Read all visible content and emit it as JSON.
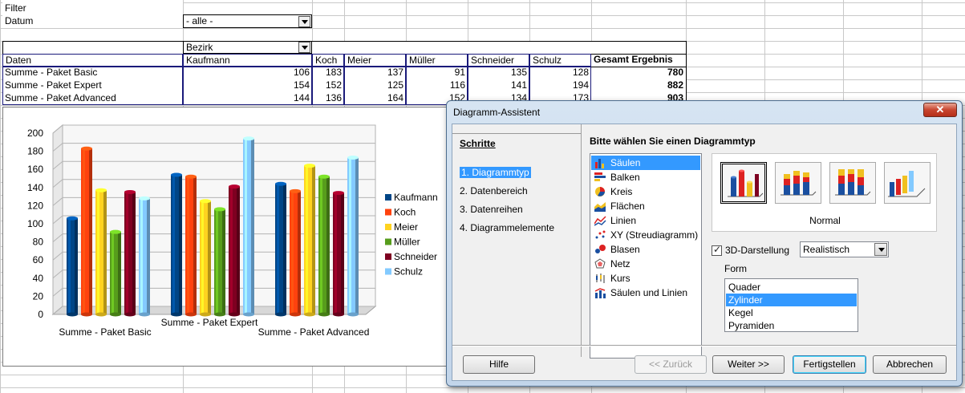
{
  "sheet": {
    "filter_label": "Filter",
    "datum_label": "Datum",
    "datum_value": "- alle -",
    "bezirk_label": "Bezirk",
    "daten_label": "Daten",
    "columns": [
      "Kaufmann",
      "Koch",
      "Meier",
      "Müller",
      "Schneider",
      "Schulz",
      "Gesamt Ergebnis"
    ],
    "rows": [
      {
        "label": "Summe - Paket Basic",
        "values": [
          "106",
          "183",
          "137",
          "91",
          "135",
          "128",
          "780"
        ]
      },
      {
        "label": "Summe - Paket Expert",
        "values": [
          "154",
          "152",
          "125",
          "116",
          "141",
          "194",
          "882"
        ]
      },
      {
        "label": "Summe - Paket Advanced",
        "values": [
          "144",
          "136",
          "164",
          "152",
          "134",
          "173",
          "903"
        ]
      }
    ]
  },
  "chart_data": {
    "type": "bar",
    "title": "",
    "categories": [
      "Summe - Paket Basic",
      "Summe - Paket Expert",
      "Summe - Paket Advanced"
    ],
    "series": [
      {
        "name": "Kaufmann",
        "values": [
          106,
          154,
          144
        ],
        "color": "#004586"
      },
      {
        "name": "Koch",
        "values": [
          183,
          152,
          136
        ],
        "color": "#ff420e"
      },
      {
        "name": "Meier",
        "values": [
          137,
          125,
          164
        ],
        "color": "#ffd320"
      },
      {
        "name": "Müller",
        "values": [
          91,
          116,
          152
        ],
        "color": "#579d1c"
      },
      {
        "name": "Schneider",
        "values": [
          135,
          141,
          134
        ],
        "color": "#7e0021"
      },
      {
        "name": "Schulz",
        "values": [
          128,
          194,
          173
        ],
        "color": "#83caff"
      }
    ],
    "ylim": [
      0,
      200
    ],
    "yticks": [
      "0",
      "20",
      "40",
      "60",
      "80",
      "100",
      "120",
      "140",
      "160",
      "180",
      "200"
    ],
    "grid": true,
    "legend": "right"
  },
  "dialog": {
    "title": "Diagramm-Assistent",
    "close_icon": "close-icon",
    "steps_heading": "Schritte",
    "steps": [
      "1. Diagrammtyp",
      "2. Datenbereich",
      "3. Datenreihen",
      "4. Diagrammelemente"
    ],
    "type_heading": "Bitte wählen Sie einen Diagrammtyp",
    "chart_types": [
      {
        "label": "Säulen",
        "icon": "column-chart-icon"
      },
      {
        "label": "Balken",
        "icon": "bar-chart-icon"
      },
      {
        "label": "Kreis",
        "icon": "pie-chart-icon"
      },
      {
        "label": "Flächen",
        "icon": "area-chart-icon"
      },
      {
        "label": "Linien",
        "icon": "line-chart-icon"
      },
      {
        "label": "XY (Streudiagramm)",
        "icon": "scatter-chart-icon"
      },
      {
        "label": "Blasen",
        "icon": "bubble-chart-icon"
      },
      {
        "label": "Netz",
        "icon": "net-chart-icon"
      },
      {
        "label": "Kurs",
        "icon": "stock-chart-icon"
      },
      {
        "label": "Säulen und Linien",
        "icon": "column-line-chart-icon"
      }
    ],
    "variant_label": "Normal",
    "threed_label": "3D-Darstellung",
    "threed_mode": "Realistisch",
    "form_label": "Form",
    "shapes": [
      "Quader",
      "Zylinder",
      "Kegel",
      "Pyramiden"
    ],
    "buttons": {
      "help": "Hilfe",
      "back": "<< Zurück",
      "next": "Weiter >>",
      "finish": "Fertigstellen",
      "cancel": "Abbrechen"
    }
  }
}
